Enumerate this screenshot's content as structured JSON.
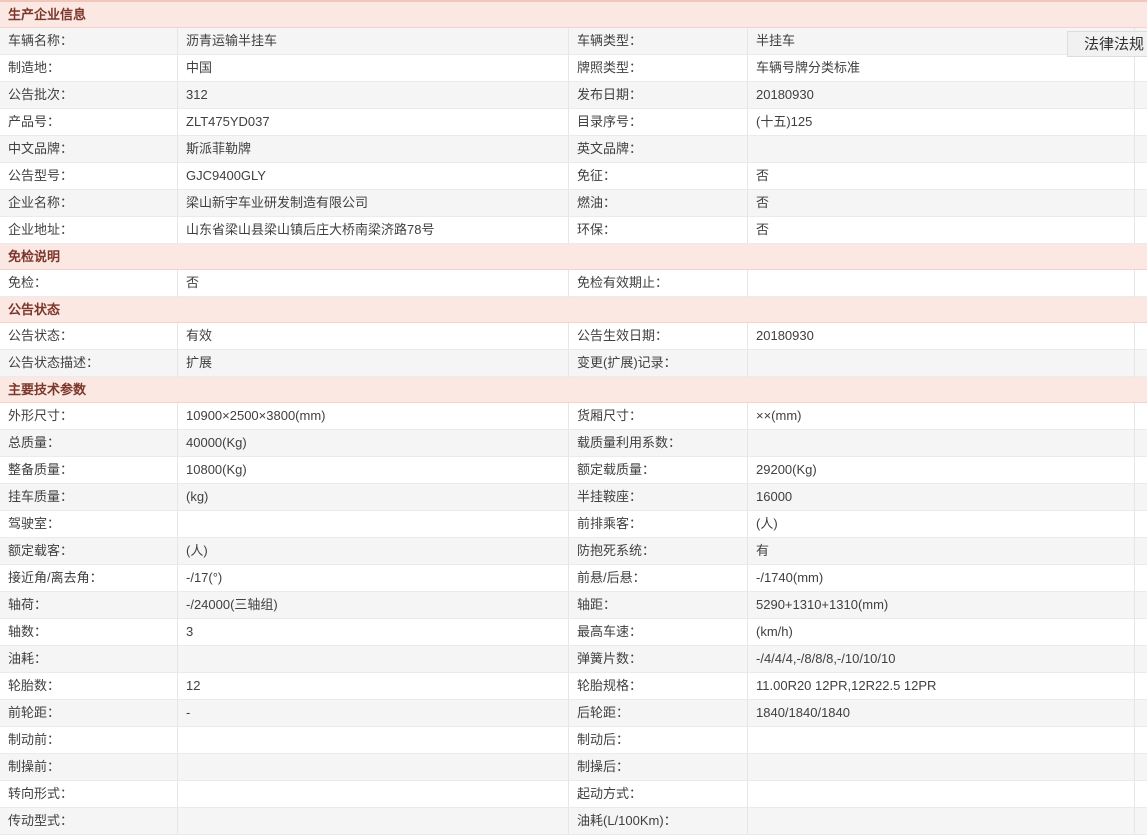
{
  "overlay": {
    "label": "法律法规"
  },
  "colors": {
    "section_bg": "#fce8e3",
    "section_text": "#7b372c",
    "section_border": "#f5d3ca",
    "stripe": "#f5f5f5",
    "border": "#e6e6e6",
    "rowline": "#ebebeb",
    "text": "#404040",
    "topline": "#f2c6ba"
  },
  "sections": [
    {
      "title": "生产企业信息",
      "rows": [
        {
          "shade": "gray",
          "cells": [
            "车辆名称：",
            "沥青运输半挂车",
            "车辆类型：",
            "半挂车"
          ]
        },
        {
          "shade": "white",
          "cells": [
            "制造地：",
            "中国",
            "牌照类型：",
            "车辆号牌分类标准"
          ]
        },
        {
          "shade": "gray",
          "cells": [
            "公告批次：",
            "312",
            "发布日期：",
            "20180930"
          ]
        },
        {
          "shade": "white",
          "cells": [
            "产品号：",
            "ZLT475YD037",
            "目录序号：",
            "(十五)125"
          ]
        },
        {
          "shade": "gray",
          "cells": [
            "中文品牌：",
            "斯派菲勒牌",
            "英文品牌：",
            ""
          ]
        },
        {
          "shade": "white",
          "cells": [
            "公告型号：",
            "GJC9400GLY",
            "免征：",
            "否"
          ]
        },
        {
          "shade": "gray",
          "cells": [
            "企业名称：",
            "梁山新宇车业研发制造有限公司",
            "燃油：",
            "否"
          ]
        },
        {
          "shade": "white",
          "cells": [
            "企业地址：",
            "山东省梁山县梁山镇后庄大桥南梁济路78号",
            "环保：",
            "否"
          ]
        }
      ]
    },
    {
      "title": "免检说明",
      "rows": [
        {
          "shade": "white",
          "cells": [
            "免检：",
            "否",
            "免检有效期止：",
            ""
          ]
        }
      ]
    },
    {
      "title": "公告状态",
      "rows": [
        {
          "shade": "white",
          "cells": [
            "公告状态：",
            "有效",
            "公告生效日期：",
            "20180930"
          ]
        },
        {
          "shade": "gray",
          "cells": [
            "公告状态描述：",
            "扩展",
            "变更(扩展)记录：",
            ""
          ]
        }
      ]
    },
    {
      "title": "主要技术参数",
      "rows": [
        {
          "shade": "white",
          "cells": [
            "外形尺寸：",
            "10900×2500×3800(mm)",
            "货厢尺寸：",
            "××(mm)"
          ]
        },
        {
          "shade": "gray",
          "cells": [
            "总质量：",
            "40000(Kg)",
            "载质量利用系数：",
            ""
          ]
        },
        {
          "shade": "white",
          "cells": [
            "整备质量：",
            "10800(Kg)",
            "额定载质量：",
            "29200(Kg)"
          ]
        },
        {
          "shade": "gray",
          "cells": [
            "挂车质量：",
            "(kg)",
            "半挂鞍座：",
            "16000"
          ]
        },
        {
          "shade": "white",
          "cells": [
            "驾驶室：",
            "",
            "前排乘客：",
            "(人)"
          ]
        },
        {
          "shade": "gray",
          "cells": [
            "额定载客：",
            "(人)",
            "防抱死系统：",
            "有"
          ]
        },
        {
          "shade": "white",
          "cells": [
            "接近角/离去角：",
            "-/17(°)",
            "前悬/后悬：",
            "-/1740(mm)"
          ]
        },
        {
          "shade": "gray",
          "cells": [
            "轴荷：",
            "-/24000(三轴组)",
            "轴距：",
            "5290+1310+1310(mm)"
          ]
        },
        {
          "shade": "white",
          "cells": [
            "轴数：",
            "3",
            "最高车速：",
            "(km/h)"
          ]
        },
        {
          "shade": "gray",
          "cells": [
            "油耗：",
            "",
            "弹簧片数：",
            "-/4/4/4,-/8/8/8,-/10/10/10"
          ]
        },
        {
          "shade": "white",
          "cells": [
            "轮胎数：",
            "12",
            "轮胎规格：",
            "11.00R20 12PR,12R22.5 12PR"
          ]
        },
        {
          "shade": "gray",
          "cells": [
            "前轮距：",
            "-",
            "后轮距：",
            "1840/1840/1840"
          ]
        },
        {
          "shade": "white",
          "cells": [
            "制动前：",
            "",
            "制动后：",
            ""
          ]
        },
        {
          "shade": "gray",
          "cells": [
            "制操前：",
            "",
            "制操后：",
            ""
          ]
        },
        {
          "shade": "white",
          "cells": [
            "转向形式：",
            "",
            "起动方式：",
            ""
          ]
        },
        {
          "shade": "gray",
          "cells": [
            "传动型式：",
            "",
            "油耗(L/100Km)：",
            ""
          ]
        }
      ]
    }
  ]
}
